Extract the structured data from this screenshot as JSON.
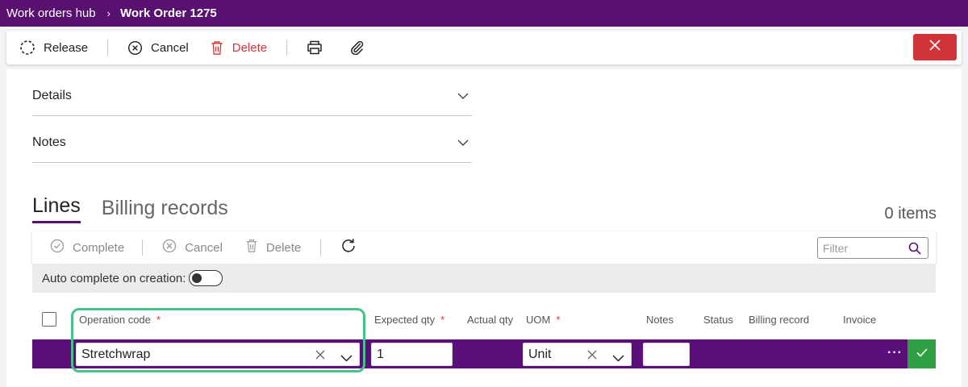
{
  "breadcrumb": {
    "parent": "Work orders hub",
    "current": "Work Order 1275"
  },
  "toolbar": {
    "release_label": "Release",
    "cancel_label": "Cancel",
    "delete_label": "Delete"
  },
  "sections": {
    "details": "Details",
    "notes": "Notes"
  },
  "tabs": {
    "lines": "Lines",
    "billing": "Billing records",
    "items_count": "0 items"
  },
  "lines_toolbar": {
    "complete_label": "Complete",
    "cancel_label": "Cancel",
    "delete_label": "Delete",
    "filter_placeholder": "Filter"
  },
  "auto_complete": {
    "label": "Auto complete on creation:",
    "enabled": false
  },
  "columns": {
    "operation_code": "Operation code",
    "expected_qty": "Expected qty",
    "actual_qty": "Actual qty",
    "uom": "UOM",
    "notes": "Notes",
    "status": "Status",
    "billing_record": "Billing record",
    "invoice": "Invoice",
    "required_marker": "*"
  },
  "row": {
    "operation_code": "Stretchwrap",
    "expected_qty": "1",
    "uom": "Unit",
    "notes": "",
    "more": "···"
  },
  "colors": {
    "brand": "#58116f",
    "row_bg": "#5a0f7a",
    "danger": "#d13438",
    "confirm": "#2ea043",
    "focus": "#47c28a"
  },
  "icons": {
    "release": "release-icon",
    "cancel": "cancel-circle-icon",
    "delete": "trash-icon",
    "print": "printer-icon",
    "attach": "paperclip-icon",
    "close": "close-icon",
    "complete": "check-circle-icon",
    "refresh": "refresh-icon",
    "search": "search-icon",
    "chevron": "chevron-down-icon",
    "confirm": "checkmark-icon"
  }
}
